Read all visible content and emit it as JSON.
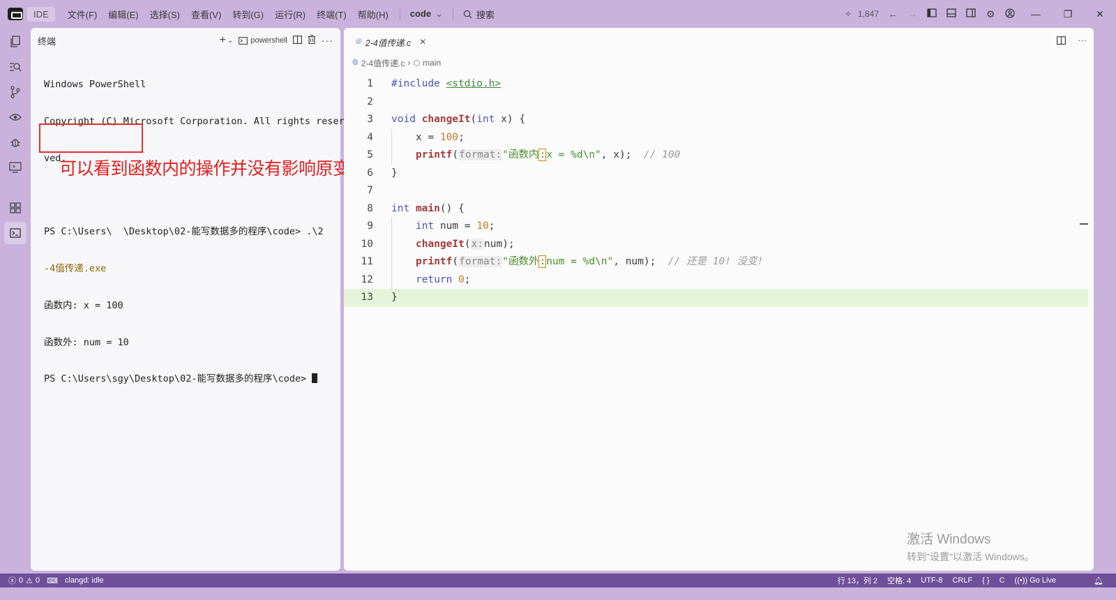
{
  "titlebar": {
    "app_name": "IDE",
    "menus": [
      "文件(F)",
      "编辑(E)",
      "选择(S)",
      "查看(V)",
      "转到(G)",
      "运行(R)",
      "终端(T)",
      "帮助(H)"
    ],
    "workspace": "code",
    "search_label": "搜索",
    "counter": "1,847"
  },
  "terminal": {
    "title": "终端",
    "shell_label": "powershell",
    "lines": [
      "Windows PowerShell",
      "Copyright (C) Microsoft Corporation. All rights reser",
      "ved.",
      "",
      "PS C:\\Users\\  \\Desktop\\02-能写数据多的程序\\code> .\\2",
      "-4值传递.exe",
      "函数内: x = 100",
      "函数外: num = 10",
      "PS C:\\Users\\sgy\\Desktop\\02-能写数据多的程序\\code> "
    ],
    "annotation": "可以看到函数内的操作并没有影响原变量"
  },
  "editor": {
    "tab_name": "2-4值传递.c",
    "breadcrumb_file": "2-4值传递.c",
    "breadcrumb_symbol": "main",
    "line_numbers": [
      "1",
      "2",
      "3",
      "4",
      "5",
      "6",
      "7",
      "8",
      "9",
      "10",
      "11",
      "12",
      "13"
    ],
    "code": {
      "l1_directive": "#include",
      "l1_header": "<stdio.h>",
      "l3_void": "void",
      "l3_name": "changeIt",
      "l3_int": "int",
      "l3_param": "x",
      "l4_stmt": "x = ",
      "l4_value": "100",
      "l5_fn": "printf",
      "l5_hint": "format:",
      "l5_str_a": "\"函数内",
      "l5_str_colon": ":",
      "l5_str_b": "x = %d\\n\"",
      "l5_args": ", x);",
      "l5_comment": "// 100",
      "l8_int": "int",
      "l8_name": "main",
      "l9_int": "int",
      "l9_stmt": "num = ",
      "l9_value": "10",
      "l10_fn": "changeIt",
      "l10_hint": "x:",
      "l10_args": "num);",
      "l11_fn": "printf",
      "l11_hint": "format:",
      "l11_str_a": "\"函数外",
      "l11_str_colon": ":",
      "l11_str_b": "num = %d\\n\"",
      "l11_args": ", num);",
      "l11_comment": "// 还是 10! 没变!",
      "l12_return": "return",
      "l12_value": "0"
    }
  },
  "watermark": {
    "title": "激活 Windows",
    "subtitle": "转到\"设置\"以激活 Windows。"
  },
  "statusbar": {
    "errors": "0",
    "warnings": "0",
    "lsp": "clangd: idle",
    "position": "行 13，列 2",
    "indent": "空格: 4",
    "encoding": "UTF-8",
    "eol": "CRLF",
    "braces": "{ }",
    "language": "C",
    "golive": "Go Live"
  }
}
